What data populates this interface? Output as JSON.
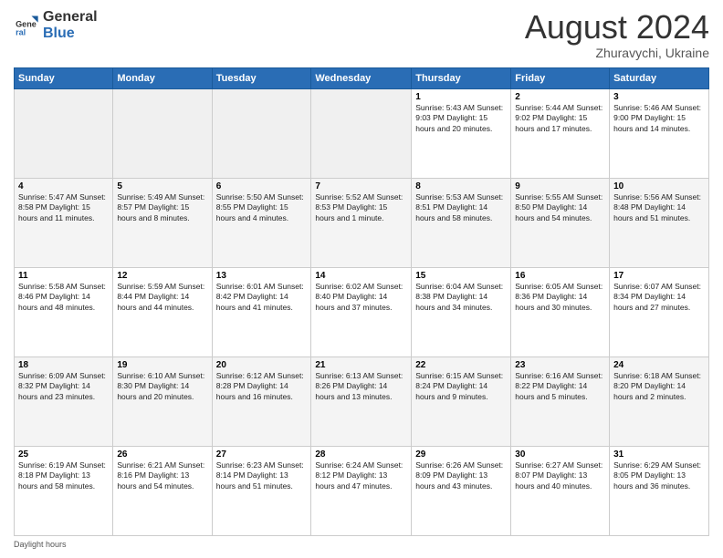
{
  "logo": {
    "general": "General",
    "blue": "Blue"
  },
  "header": {
    "month": "August 2024",
    "location": "Zhuravychi, Ukraine"
  },
  "days_of_week": [
    "Sunday",
    "Monday",
    "Tuesday",
    "Wednesday",
    "Thursday",
    "Friday",
    "Saturday"
  ],
  "weeks": [
    [
      {
        "day": "",
        "info": ""
      },
      {
        "day": "",
        "info": ""
      },
      {
        "day": "",
        "info": ""
      },
      {
        "day": "",
        "info": ""
      },
      {
        "day": "1",
        "info": "Sunrise: 5:43 AM\nSunset: 9:03 PM\nDaylight: 15 hours and 20 minutes."
      },
      {
        "day": "2",
        "info": "Sunrise: 5:44 AM\nSunset: 9:02 PM\nDaylight: 15 hours and 17 minutes."
      },
      {
        "day": "3",
        "info": "Sunrise: 5:46 AM\nSunset: 9:00 PM\nDaylight: 15 hours and 14 minutes."
      }
    ],
    [
      {
        "day": "4",
        "info": "Sunrise: 5:47 AM\nSunset: 8:58 PM\nDaylight: 15 hours and 11 minutes."
      },
      {
        "day": "5",
        "info": "Sunrise: 5:49 AM\nSunset: 8:57 PM\nDaylight: 15 hours and 8 minutes."
      },
      {
        "day": "6",
        "info": "Sunrise: 5:50 AM\nSunset: 8:55 PM\nDaylight: 15 hours and 4 minutes."
      },
      {
        "day": "7",
        "info": "Sunrise: 5:52 AM\nSunset: 8:53 PM\nDaylight: 15 hours and 1 minute."
      },
      {
        "day": "8",
        "info": "Sunrise: 5:53 AM\nSunset: 8:51 PM\nDaylight: 14 hours and 58 minutes."
      },
      {
        "day": "9",
        "info": "Sunrise: 5:55 AM\nSunset: 8:50 PM\nDaylight: 14 hours and 54 minutes."
      },
      {
        "day": "10",
        "info": "Sunrise: 5:56 AM\nSunset: 8:48 PM\nDaylight: 14 hours and 51 minutes."
      }
    ],
    [
      {
        "day": "11",
        "info": "Sunrise: 5:58 AM\nSunset: 8:46 PM\nDaylight: 14 hours and 48 minutes."
      },
      {
        "day": "12",
        "info": "Sunrise: 5:59 AM\nSunset: 8:44 PM\nDaylight: 14 hours and 44 minutes."
      },
      {
        "day": "13",
        "info": "Sunrise: 6:01 AM\nSunset: 8:42 PM\nDaylight: 14 hours and 41 minutes."
      },
      {
        "day": "14",
        "info": "Sunrise: 6:02 AM\nSunset: 8:40 PM\nDaylight: 14 hours and 37 minutes."
      },
      {
        "day": "15",
        "info": "Sunrise: 6:04 AM\nSunset: 8:38 PM\nDaylight: 14 hours and 34 minutes."
      },
      {
        "day": "16",
        "info": "Sunrise: 6:05 AM\nSunset: 8:36 PM\nDaylight: 14 hours and 30 minutes."
      },
      {
        "day": "17",
        "info": "Sunrise: 6:07 AM\nSunset: 8:34 PM\nDaylight: 14 hours and 27 minutes."
      }
    ],
    [
      {
        "day": "18",
        "info": "Sunrise: 6:09 AM\nSunset: 8:32 PM\nDaylight: 14 hours and 23 minutes."
      },
      {
        "day": "19",
        "info": "Sunrise: 6:10 AM\nSunset: 8:30 PM\nDaylight: 14 hours and 20 minutes."
      },
      {
        "day": "20",
        "info": "Sunrise: 6:12 AM\nSunset: 8:28 PM\nDaylight: 14 hours and 16 minutes."
      },
      {
        "day": "21",
        "info": "Sunrise: 6:13 AM\nSunset: 8:26 PM\nDaylight: 14 hours and 13 minutes."
      },
      {
        "day": "22",
        "info": "Sunrise: 6:15 AM\nSunset: 8:24 PM\nDaylight: 14 hours and 9 minutes."
      },
      {
        "day": "23",
        "info": "Sunrise: 6:16 AM\nSunset: 8:22 PM\nDaylight: 14 hours and 5 minutes."
      },
      {
        "day": "24",
        "info": "Sunrise: 6:18 AM\nSunset: 8:20 PM\nDaylight: 14 hours and 2 minutes."
      }
    ],
    [
      {
        "day": "25",
        "info": "Sunrise: 6:19 AM\nSunset: 8:18 PM\nDaylight: 13 hours and 58 minutes."
      },
      {
        "day": "26",
        "info": "Sunrise: 6:21 AM\nSunset: 8:16 PM\nDaylight: 13 hours and 54 minutes."
      },
      {
        "day": "27",
        "info": "Sunrise: 6:23 AM\nSunset: 8:14 PM\nDaylight: 13 hours and 51 minutes."
      },
      {
        "day": "28",
        "info": "Sunrise: 6:24 AM\nSunset: 8:12 PM\nDaylight: 13 hours and 47 minutes."
      },
      {
        "day": "29",
        "info": "Sunrise: 6:26 AM\nSunset: 8:09 PM\nDaylight: 13 hours and 43 minutes."
      },
      {
        "day": "30",
        "info": "Sunrise: 6:27 AM\nSunset: 8:07 PM\nDaylight: 13 hours and 40 minutes."
      },
      {
        "day": "31",
        "info": "Sunrise: 6:29 AM\nSunset: 8:05 PM\nDaylight: 13 hours and 36 minutes."
      }
    ]
  ],
  "footer": {
    "note": "Daylight hours"
  }
}
